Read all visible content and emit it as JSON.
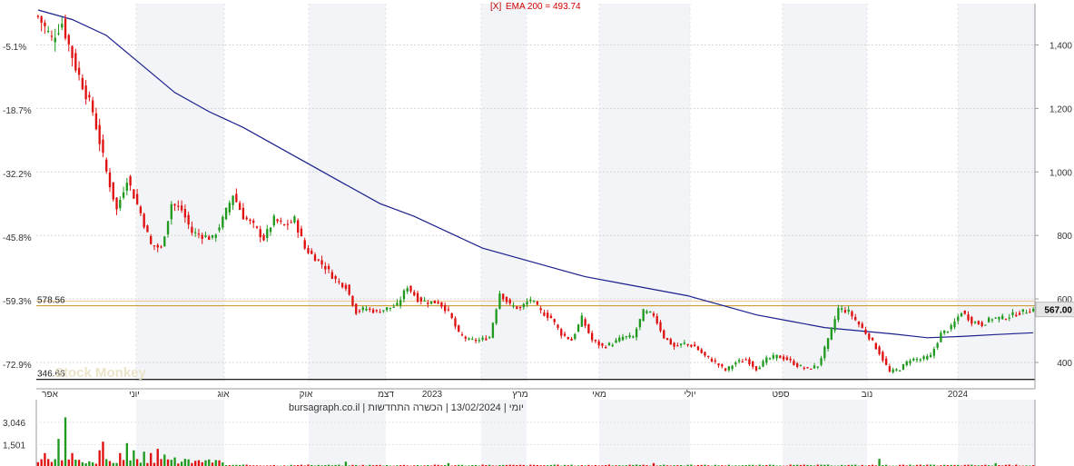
{
  "header": {
    "legend_marker": "[X]",
    "legend_label": "EMA 200 = 493.74"
  },
  "footer": {
    "info_text": "יומי | 13/02/2024 | הכשרה התחדשות | bursagraph.co.il"
  },
  "watermark": "Stock Monkey",
  "colors": {
    "up": "#1f9a1f",
    "down": "#e01010",
    "ema": "#1a1f8c",
    "last_price_tag": "#e6e6e6",
    "shade_band": "#f2f4f7",
    "hline_upper": "#c8901c",
    "hline_lower": "#000000"
  },
  "chart_data": [
    {
      "type": "candlestick",
      "title": "",
      "x_tick_labels": [
        "אפר",
        "יוני",
        "אוג",
        "אוק",
        "דצמ",
        "2023",
        "מרץ",
        "מאי",
        "יולי",
        "ספט",
        "נוב",
        "2024"
      ],
      "y_right_ticks": [
        400,
        600,
        800,
        "1,000",
        "1,200",
        "1,400"
      ],
      "y_left_ticks": [
        "-5.1%",
        "-18.7%",
        "-32.2%",
        "-45.8%",
        "-59.3%",
        "-72.9%"
      ],
      "ylim": [
        340,
        1530
      ],
      "grid": true,
      "last_price": "567.00",
      "horizontal_lines": [
        {
          "label": "578.56",
          "value": 578.56
        },
        {
          "label": "346.66",
          "value": 346.66
        }
      ],
      "ema": {
        "name": "EMA 200",
        "value": 493.74
      },
      "price_path": [
        [
          0,
          1490
        ],
        [
          4,
          1420
        ],
        [
          7,
          1470
        ],
        [
          11,
          1330
        ],
        [
          16,
          1190
        ],
        [
          20,
          1000
        ],
        [
          23,
          880
        ],
        [
          26,
          980
        ],
        [
          30,
          870
        ],
        [
          33,
          770
        ],
        [
          36,
          760
        ],
        [
          39,
          900
        ],
        [
          42,
          880
        ],
        [
          45,
          810
        ],
        [
          48,
          800
        ],
        [
          51,
          790
        ],
        [
          54,
          850
        ],
        [
          57,
          930
        ],
        [
          60,
          860
        ],
        [
          63,
          830
        ],
        [
          66,
          790
        ],
        [
          69,
          850
        ],
        [
          72,
          830
        ],
        [
          75,
          850
        ],
        [
          78,
          760
        ],
        [
          81,
          730
        ],
        [
          84,
          700
        ],
        [
          87,
          660
        ],
        [
          90,
          640
        ],
        [
          93,
          560
        ],
        [
          96,
          570
        ],
        [
          99,
          560
        ],
        [
          102,
          570
        ],
        [
          105,
          580
        ],
        [
          108,
          640
        ],
        [
          111,
          600
        ],
        [
          114,
          590
        ],
        [
          117,
          590
        ],
        [
          120,
          560
        ],
        [
          123,
          490
        ],
        [
          126,
          470
        ],
        [
          129,
          470
        ],
        [
          132,
          480
        ],
        [
          135,
          620
        ],
        [
          138,
          580
        ],
        [
          141,
          570
        ],
        [
          144,
          600
        ],
        [
          147,
          560
        ],
        [
          150,
          540
        ],
        [
          153,
          490
        ],
        [
          156,
          470
        ],
        [
          159,
          540
        ],
        [
          162,
          470
        ],
        [
          165,
          450
        ],
        [
          168,
          460
        ],
        [
          171,
          480
        ],
        [
          174,
          480
        ],
        [
          177,
          560
        ],
        [
          180,
          550
        ],
        [
          183,
          480
        ],
        [
          186,
          450
        ],
        [
          189,
          460
        ],
        [
          192,
          450
        ],
        [
          195,
          420
        ],
        [
          198,
          400
        ],
        [
          201,
          375
        ],
        [
          204,
          400
        ],
        [
          207,
          410
        ],
        [
          210,
          380
        ],
        [
          213,
          410
        ],
        [
          216,
          420
        ],
        [
          219,
          410
        ],
        [
          222,
          390
        ],
        [
          225,
          380
        ],
        [
          228,
          390
        ],
        [
          231,
          470
        ],
        [
          234,
          570
        ],
        [
          237,
          560
        ],
        [
          240,
          520
        ],
        [
          243,
          480
        ],
        [
          246,
          430
        ],
        [
          249,
          370
        ],
        [
          252,
          380
        ],
        [
          255,
          410
        ],
        [
          258,
          410
        ],
        [
          261,
          420
        ],
        [
          264,
          490
        ],
        [
          267,
          510
        ],
        [
          270,
          560
        ],
        [
          273,
          530
        ],
        [
          276,
          520
        ],
        [
          279,
          540
        ],
        [
          282,
          540
        ],
        [
          285,
          550
        ],
        [
          288,
          560
        ],
        [
          291,
          567
        ]
      ],
      "ema_path": [
        [
          0,
          1510
        ],
        [
          10,
          1480
        ],
        [
          20,
          1430
        ],
        [
          30,
          1340
        ],
        [
          40,
          1250
        ],
        [
          50,
          1190
        ],
        [
          60,
          1140
        ],
        [
          70,
          1080
        ],
        [
          80,
          1020
        ],
        [
          90,
          960
        ],
        [
          100,
          900
        ],
        [
          110,
          860
        ],
        [
          120,
          810
        ],
        [
          130,
          760
        ],
        [
          140,
          730
        ],
        [
          150,
          700
        ],
        [
          160,
          670
        ],
        [
          170,
          650
        ],
        [
          180,
          630
        ],
        [
          190,
          610
        ],
        [
          200,
          580
        ],
        [
          210,
          550
        ],
        [
          220,
          530
        ],
        [
          230,
          510
        ],
        [
          240,
          500
        ],
        [
          250,
          490
        ],
        [
          260,
          478
        ],
        [
          270,
          482
        ],
        [
          280,
          488
        ],
        [
          291,
          493.74
        ]
      ],
      "volume_ticks": [
        "3,046",
        "1,501"
      ],
      "volume_events": [
        [
          2,
          0.9
        ],
        [
          6,
          1.9
        ],
        [
          8,
          3.4
        ],
        [
          10,
          0.9
        ],
        [
          18,
          1.1
        ],
        [
          19,
          1.7
        ],
        [
          24,
          0.9
        ],
        [
          26,
          1.6
        ],
        [
          28,
          1.1
        ],
        [
          31,
          1.0
        ],
        [
          33,
          0.9
        ],
        [
          35,
          1.2
        ],
        [
          37,
          0.8
        ],
        [
          40,
          0.6
        ],
        [
          43,
          0.5
        ],
        [
          49,
          0.4
        ],
        [
          90,
          0.3
        ],
        [
          120,
          0.2
        ],
        [
          180,
          0.2
        ],
        [
          246,
          0.5
        ],
        [
          280,
          0.2
        ]
      ]
    }
  ]
}
